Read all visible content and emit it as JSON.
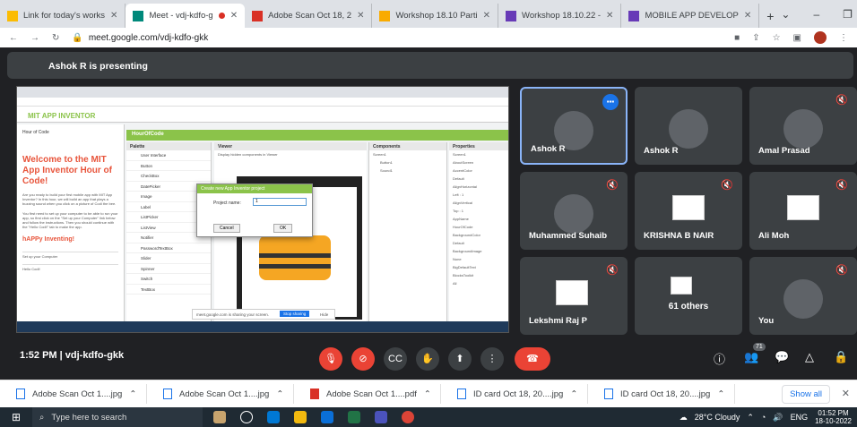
{
  "browser": {
    "tabs": [
      {
        "title": "Link for today's works",
        "color": "#fbbc04",
        "active": false
      },
      {
        "title": "Meet - vdj-kdfo-g",
        "color": "#00897b",
        "active": true
      },
      {
        "title": "Adobe Scan Oct 18, 2",
        "color": "#d93025",
        "active": false
      },
      {
        "title": "Workshop 18.10 Parti",
        "color": "#f9ab00",
        "active": false
      },
      {
        "title": "Workshop 18.10.22 - ",
        "color": "#673ab7",
        "active": false
      },
      {
        "title": "MOBILE APP DEVELOP",
        "color": "#673ab7",
        "active": false
      }
    ],
    "new_tab": "+",
    "url": "meet.google.com/vdj-kdfo-gkk"
  },
  "meet": {
    "presenting_label": "Ashok R is presenting",
    "time_meeting": "1:52 PM  |  vdj-kdfo-gkk",
    "participants_count": "71",
    "tiles": [
      {
        "name": "Ashok R",
        "active": true,
        "speaking": true
      },
      {
        "name": "Ashok R",
        "active": false
      },
      {
        "name": "Amal Prasad",
        "active": false,
        "muted": true
      },
      {
        "name": "Muhammed Suhaib",
        "muted": true
      },
      {
        "name": "KRISHNA B NAIR",
        "muted": true,
        "photo": true
      },
      {
        "name": "Ali Moh",
        "muted": true,
        "photo": true
      },
      {
        "name": "Lekshmi Raj P",
        "muted": true,
        "photo": true
      },
      {
        "name": "61 others",
        "photo": true
      },
      {
        "name": "You",
        "muted": true
      }
    ]
  },
  "shared": {
    "app_name": "MIT APP INVENTOR",
    "tab_hoc": "Hour of Code",
    "welcome": "Welcome to the MIT App Inventor Hour of Code!",
    "intro": "Are you ready to build your first mobile app with MIT App Inventor? In this hour, we will build an app that plays a buzzing sound when you click on a picture of Codi the bee.",
    "intro2": "You first need to set up your computer to be able to run your app, so first click on the \"Set up your Computer\" link below and follow the instructions. Then you should continue with the \"Hello Codi!\" tab to make the app.",
    "happy": "hAPPy Inventing!",
    "setup_link": "Set up your Computer",
    "hello_link": "Hello Codi!",
    "project": "HourOfCode",
    "palette_head": "Palette",
    "palette_items": [
      "User Interface",
      "Button",
      "CheckBox",
      "DatePicker",
      "Image",
      "Label",
      "ListPicker",
      "ListView",
      "Notifier",
      "PasswordTextBox",
      "Slider",
      "Spinner",
      "Switch",
      "TextBox"
    ],
    "viewer_head": "Viewer",
    "viewer_check": "Display hidden components in Viewer",
    "components_head": "Components",
    "components_items": [
      "Screen1",
      "Button1",
      "Sound1"
    ],
    "properties_head": "Properties",
    "properties_items": [
      "Screen1",
      "AboutScreen",
      "AccentColor",
      "Default",
      "AlignHorizontal",
      "Left : 1",
      "AlignVertical",
      "Top : 1",
      "AppName",
      "HourOfCode",
      "BackgroundColor",
      "Default",
      "BackgroundImage",
      "None",
      "BigDefaultText",
      "BlocksToolkit",
      "All"
    ],
    "dialog_title": "Create new App Inventor project",
    "dialog_label": "Project name:",
    "dialog_value": "1",
    "dialog_cancel": "Cancel",
    "dialog_ok": "OK",
    "share_bar": "meet.google.com is sharing your screen.",
    "stop_sharing": "Stop sharing",
    "hide": "Hide"
  },
  "downloads": [
    {
      "name": "Adobe Scan Oct 1....jpg",
      "type": "img"
    },
    {
      "name": "Adobe Scan Oct 1....jpg",
      "type": "img"
    },
    {
      "name": "Adobe Scan Oct 1....pdf",
      "type": "pdf"
    },
    {
      "name": "ID card Oct 18, 20....jpg",
      "type": "img"
    },
    {
      "name": "ID card Oct 18, 20....jpg",
      "type": "img"
    }
  ],
  "show_all": "Show all",
  "taskbar": {
    "search_placeholder": "Type here to search",
    "weather": "28°C Cloudy",
    "lang": "ENG",
    "time": "01:52 PM",
    "date": "18-10-2022"
  }
}
